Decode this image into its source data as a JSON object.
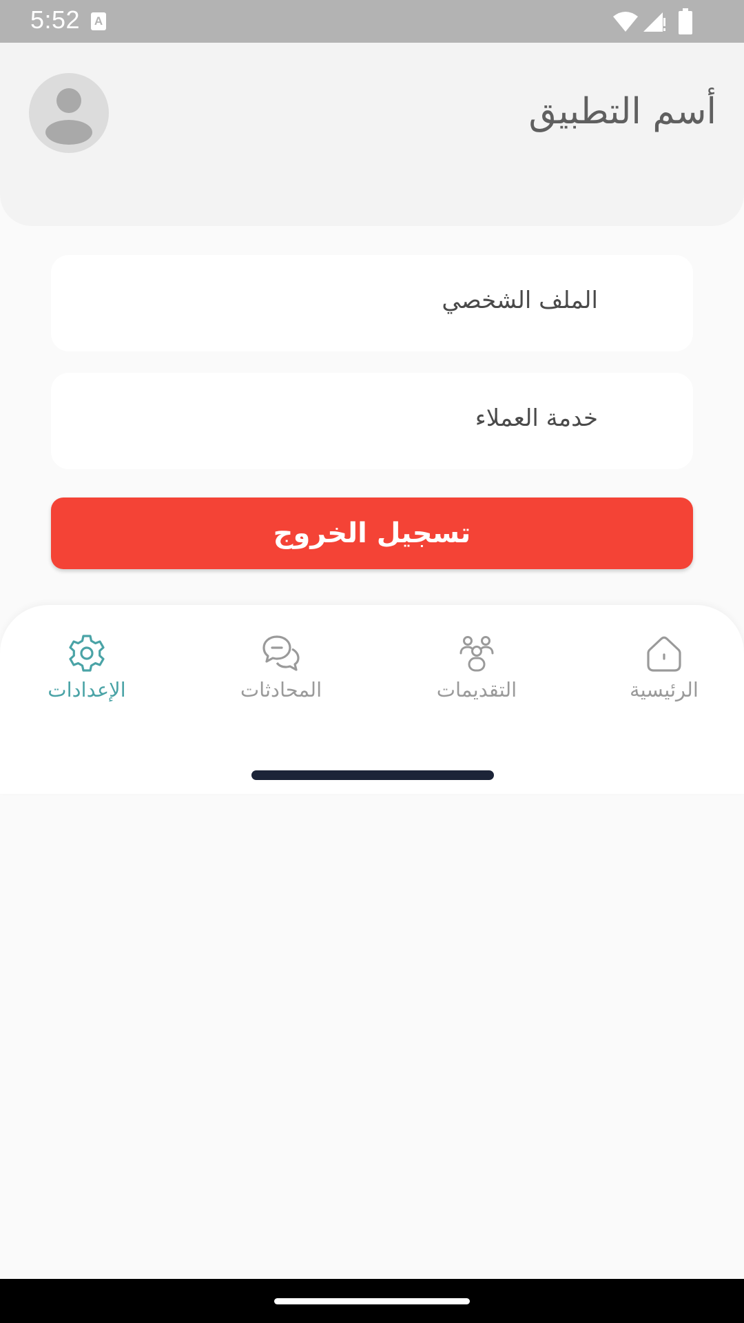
{
  "status_bar": {
    "time": "5:52",
    "notification_icon": "a-keyboard-icon",
    "icons": [
      "wifi-icon",
      "signal-icon",
      "battery-icon"
    ]
  },
  "header": {
    "app_title": "أسم التطبيق",
    "avatar_icon": "person-icon"
  },
  "menu": {
    "items": [
      {
        "label": "الملف الشخصي"
      },
      {
        "label": "خدمة العملاء"
      }
    ],
    "logout_label": "تسجيل الخروج"
  },
  "bottom_nav": {
    "items": [
      {
        "label": "الرئيسية",
        "icon": "home-icon",
        "active": false
      },
      {
        "label": "التقديمات",
        "icon": "people-icon",
        "active": false
      },
      {
        "label": "المحادثات",
        "icon": "chat-icon",
        "active": false
      },
      {
        "label": "الإعدادات",
        "icon": "gear-icon",
        "active": true
      }
    ]
  },
  "colors": {
    "accent": "#4aa3a6",
    "logout": "#f44336",
    "inactive": "#9a9a9a"
  }
}
